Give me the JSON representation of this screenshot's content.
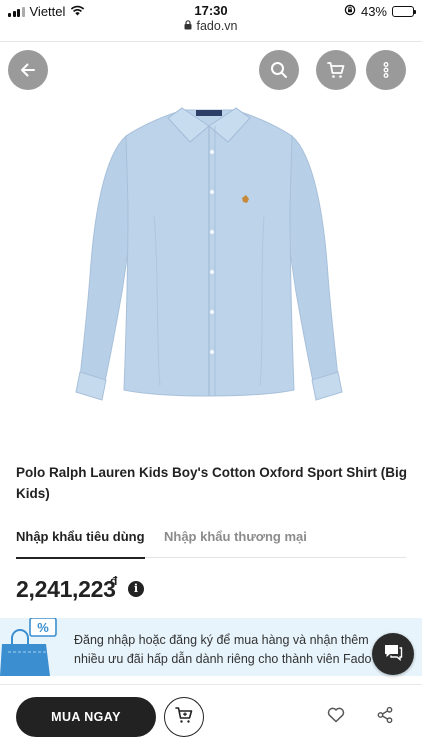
{
  "status_bar": {
    "carrier": "Viettel",
    "time": "17:30",
    "url": "fado.vn",
    "battery": "43%",
    "battery_level": 0.43
  },
  "header": {
    "icons": [
      "back-arrow-icon",
      "search-icon",
      "cart-icon",
      "more-vertical-icon"
    ]
  },
  "product": {
    "title": "Polo Ralph Lauren Kids Boy's Cotton Oxford Sport Shirt (Big Kids)",
    "image": "light-blue-oxford-shirt"
  },
  "tabs": [
    {
      "label": "Nhập khẩu tiêu dùng",
      "active": true
    },
    {
      "label": "Nhập khẩu thương mại",
      "active": false
    }
  ],
  "price": {
    "amount": "2,241,223",
    "currency": "đ",
    "info_glyph": "i"
  },
  "promo": {
    "badge_glyph": "%",
    "line1": "Đăng nhập hoặc đăng ký để mua hàng và nhận thêm",
    "line2": "nhiều ưu đãi hấp dẫn dành riêng cho thành viên Fado"
  },
  "actions": {
    "buy_label": "MUA NGAY"
  },
  "colors": {
    "primary_dark": "#222222",
    "fab_gray": "#9a9a9a",
    "promo_bg": "#e7f4fc",
    "promo_accent": "#3b8fd0",
    "shirt_blue": "#bcd3ea"
  }
}
